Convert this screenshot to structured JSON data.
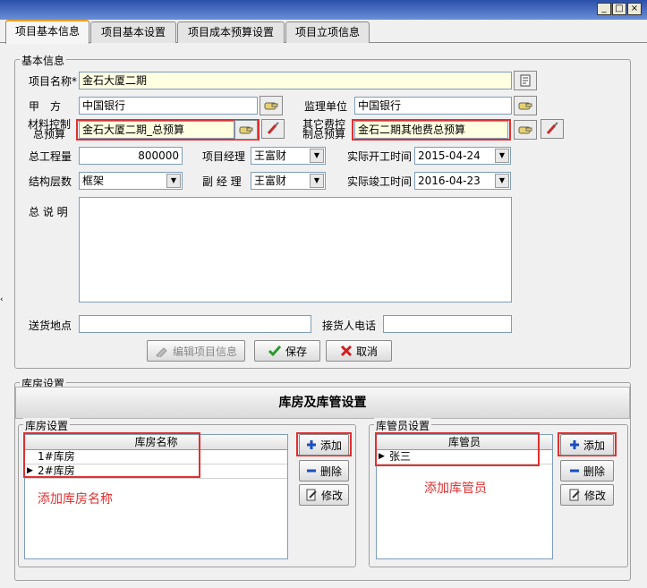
{
  "window": {
    "min": "_",
    "max": "□",
    "close": "×"
  },
  "tabs": [
    "项目基本信息",
    "项目基本设置",
    "项目成本预算设置",
    "项目立项信息"
  ],
  "basic": {
    "legend": "基本信息",
    "project_name_label": "项目名称*",
    "project_name": "金石大厦二期",
    "party_a_label": "甲　方",
    "party_a": "中国银行",
    "supervisor_label": "监理单位",
    "supervisor": "中国银行",
    "material_label": [
      "材料控制",
      "总预算"
    ],
    "material_budget": "金石大厦二期_总预算",
    "other_label": [
      "其它费控",
      "制总预算"
    ],
    "other_budget": "金石二期其他费总预算",
    "quantity_label": "总工程量",
    "quantity": "800000",
    "manager_label": "项目经理",
    "manager": "王富财",
    "start_label": "实际开工时间",
    "start_date": "2015-04-24",
    "structure_label": "结构层数",
    "structure": "框架",
    "deputy_label": "副 经 理",
    "deputy": "王富财",
    "end_label": "实际竣工时间",
    "end_date": "2016-04-23",
    "desc_label": "总 说 明",
    "desc": "",
    "delivery_label": "送货地点",
    "delivery": "",
    "phone_label": "接货人电话",
    "phone": "",
    "edit_btn": "编辑项目信息",
    "save_btn": "保存",
    "cancel_btn": "取消"
  },
  "warehouse": {
    "legend": "库房设置",
    "title": "库房及库管设置",
    "rooms_legend": "库房设置",
    "rooms_header": "库房名称",
    "rooms": [
      "1#库房",
      "2#库房"
    ],
    "keepers_legend": "库管员设置",
    "keepers_header": "库管员",
    "keepers": [
      "张三"
    ],
    "add_btn": "添加",
    "delete_btn": "删除",
    "modify_btn": "修改",
    "note_rooms": "添加库房名称",
    "note_keepers": "添加库管员"
  },
  "colors": {
    "annotation": "#e03030",
    "required_bg": "#ffffe1"
  }
}
